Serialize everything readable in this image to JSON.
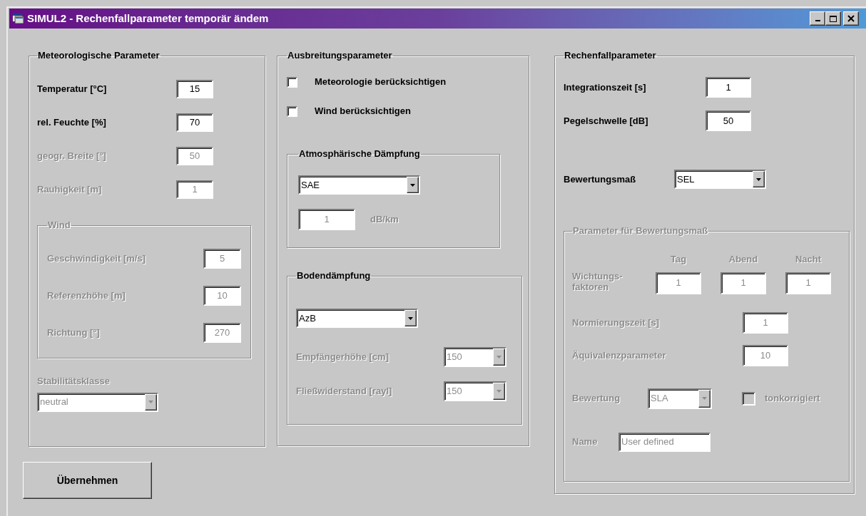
{
  "window": {
    "title": "SIMUL2 - Rechenfallparameter temporär ändem"
  },
  "meteorology": {
    "title": "Meteorologische Parameter",
    "fields": [
      {
        "label": "Temperatur [°C]",
        "value": "15",
        "disabled": false
      },
      {
        "label": "rel. Feuchte [%]",
        "value": "70",
        "disabled": false
      },
      {
        "label": "geogr. Breite  [°]",
        "value": "50",
        "disabled": true
      },
      {
        "label": "Rauhigkeit [m]",
        "value": "1",
        "disabled": true
      }
    ],
    "wind": {
      "title": "Wind",
      "disabled": true,
      "fields": [
        {
          "label": "Geschwindigkeit [m/s]",
          "value": "5"
        },
        {
          "label": "Referenzhöhe [m]",
          "value": "10"
        },
        {
          "label": "Richtung [°]",
          "value": "270"
        }
      ]
    },
    "stability": {
      "label": "Stabilitätsklasse",
      "value": "neutral",
      "disabled": true
    }
  },
  "propagation": {
    "title": "Ausbreitungsparameter",
    "checkboxes": [
      {
        "label": "Meteorologie berücksichtigen",
        "checked": false
      },
      {
        "label": "Wind berücksichtigen",
        "checked": false
      }
    ],
    "atmospheric": {
      "title": "Atmosphärische Dämpfung",
      "method": "SAE",
      "attenuation": {
        "value": "1",
        "unit": "dB/km",
        "disabled": true
      }
    },
    "ground": {
      "title": "Bodendämpfung",
      "method": "AzB",
      "fields": [
        {
          "label": "Empfängerhöhe [cm]",
          "value": "150",
          "disabled": true
        },
        {
          "label": "Fließwiderstand [rayl]",
          "value": "150",
          "disabled": true
        }
      ]
    }
  },
  "calculation": {
    "title": "Rechenfallparameter",
    "fields": [
      {
        "label": "Integrationszeit [s]",
        "value": "1"
      },
      {
        "label": "Pegelschwelle [dB]",
        "value": "50"
      }
    ],
    "metric": {
      "label": "Bewertungsmaß",
      "value": "SEL"
    },
    "metric_params": {
      "title": "Parameter für Bewertungsmaß",
      "disabled": true,
      "weights_label": "Wichtungs-\nfaktoren",
      "weights": [
        {
          "label": "Tag",
          "value": "1"
        },
        {
          "label": "Abend",
          "value": "1"
        },
        {
          "label": "Nacht",
          "value": "1"
        }
      ],
      "fields": [
        {
          "label": "Normierungszeit [s]",
          "value": "1"
        },
        {
          "label": "Äquivalenzparameter",
          "value": "10"
        }
      ],
      "weighting": {
        "label": "Bewertung",
        "value": "SLA"
      },
      "tone_corrected": {
        "label": "tonkorrigiert",
        "checked": false
      },
      "name": {
        "label": "Name",
        "value": "User defined"
      }
    }
  },
  "apply_button": {
    "label": "Übernehmen"
  }
}
